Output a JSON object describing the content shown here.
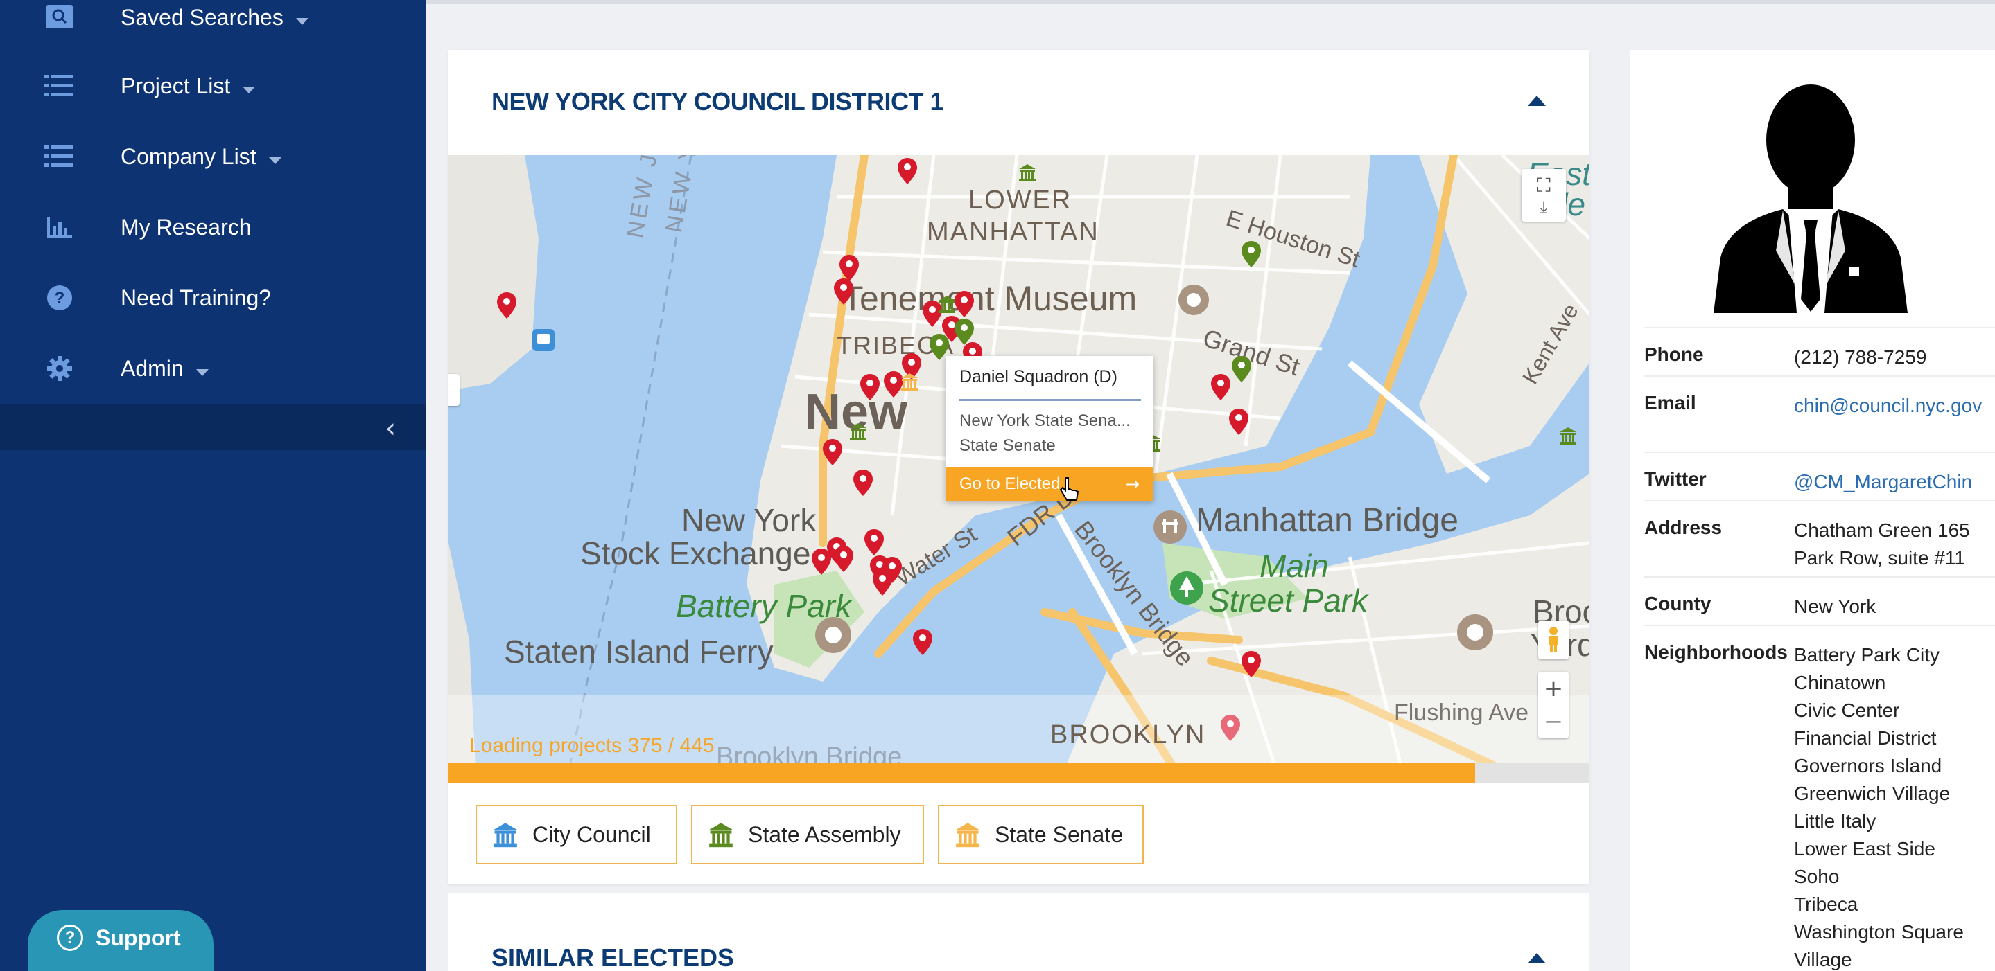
{
  "sidebar": {
    "items": [
      {
        "label": "Saved Searches",
        "icon": "search-icon",
        "dropdown": true
      },
      {
        "label": "Project List",
        "icon": "list-icon",
        "dropdown": true
      },
      {
        "label": "Company List",
        "icon": "list-icon",
        "dropdown": true
      },
      {
        "label": "My Research",
        "icon": "bar-chart-icon",
        "dropdown": false
      },
      {
        "label": "Need Training?",
        "icon": "question-circle-icon",
        "dropdown": false
      },
      {
        "label": "Admin",
        "icon": "gear-icon",
        "dropdown": true
      }
    ],
    "collapse_glyph": "‹",
    "support_label": "Support"
  },
  "district": {
    "title": "NEW YORK CITY COUNCIL DISTRICT 1"
  },
  "map": {
    "labels": {
      "lower_manhattan_1": "LOWER",
      "lower_manhattan_2": "MANHATTAN",
      "tenement": "Tenement Museum",
      "tribeca": "TRIBECA",
      "new": "New",
      "nyse_1": "New York",
      "nyse_2": "Stock Exchange",
      "battery_park": "Battery Park",
      "staten_ferry": "Staten Island Ferry",
      "water_st": "Water St",
      "fdr": "FDR Dr",
      "brooklyn_bridge_road": "Brooklyn Bridge",
      "manhattan_bridge": "Manhattan Bridge",
      "main_street_park_1": "Main",
      "main_street_park_2": "Street Park",
      "brooklyn": "BROOKLYN",
      "brooklyn_bridge_bottom": "Brooklyn Bridge",
      "flushing": "Flushing Ave",
      "houston": "E Houston St",
      "grand": "Grand St",
      "kent": "Kent Ave",
      "new_jersey": "NEW JERSEY",
      "new_york_vert": "NEW YORK",
      "east_side": "East",
      "east_side_2": "Side",
      "brooklyn_navy_1": "Brook",
      "brooklyn_navy_2": "Yard"
    },
    "popup": {
      "name": "Daniel Squadron (D)",
      "line1": "New York State Sena...",
      "line2": "State Senate",
      "action": "Go to Elected"
    },
    "loading_text": "Loading projects 375 / 445",
    "loading_progress": 0.9,
    "zoom_in": "+",
    "zoom_out": "−",
    "colors": {
      "city_council": "#3d8fd8",
      "state_assembly": "#5b8a1e",
      "state_senate": "#f5b54a",
      "project_pin": "#d7192c"
    }
  },
  "legend": [
    {
      "label": "City Council",
      "icon": "capitol-icon-blue"
    },
    {
      "label": "State Assembly",
      "icon": "capitol-icon-green"
    },
    {
      "label": "State Senate",
      "icon": "capitol-icon-orange"
    }
  ],
  "similar": {
    "title": "SIMILAR ELECTEDS"
  },
  "profile": {
    "phone_label": "Phone",
    "phone": "(212) 788-7259",
    "email_label": "Email",
    "email": "chin@council.nyc.gov",
    "twitter_label": "Twitter",
    "twitter": "@CM_MargaretChin",
    "address_label": "Address",
    "address": "Chatham Green 165 Park Row, suite #11",
    "county_label": "County",
    "county": "New York",
    "neighborhoods_label": "Neighborhoods",
    "neighborhoods": [
      "Battery Park City",
      "Chinatown",
      "Civic Center",
      "Financial District",
      "Governors Island",
      "Greenwich Village",
      "Little Italy",
      "Lower East Side",
      "Soho",
      "Tribeca",
      "Washington Square Village"
    ]
  }
}
